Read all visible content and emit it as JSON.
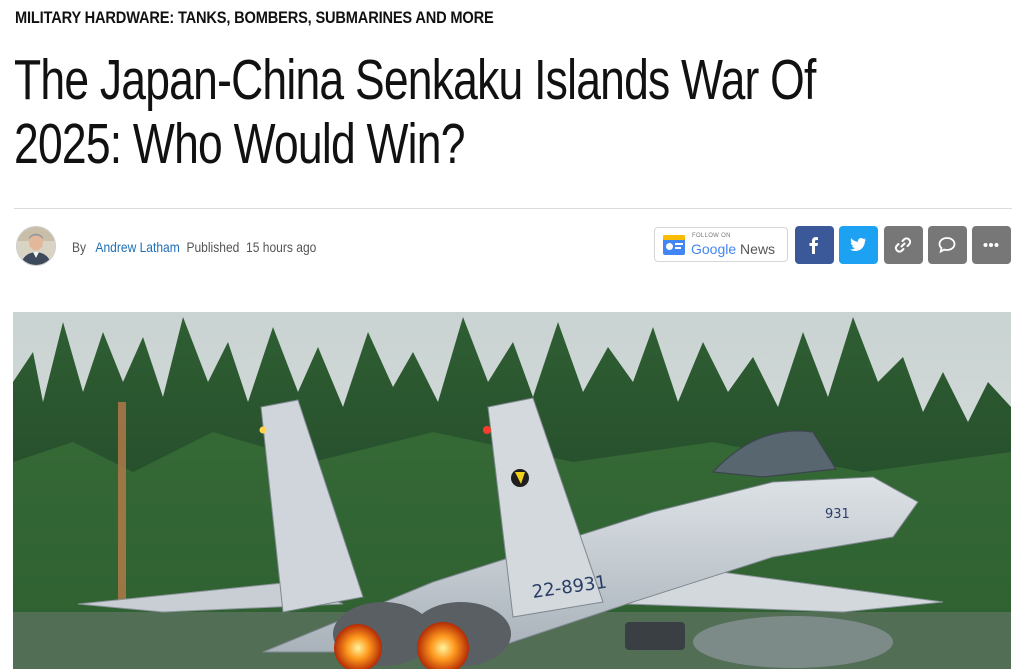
{
  "article": {
    "category": "MILITARY HARDWARE: TANKS, BOMBERS, SUBMARINES AND MORE",
    "title": "The Japan-China Senkaku Islands War Of 2025: Who Would Win?",
    "byline": {
      "by_label": "By",
      "author": "Andrew Latham",
      "published_label": "Published",
      "time": "15 hours ago"
    }
  },
  "follow_button": {
    "small_label": "FOLLOW ON",
    "label_google": "Google",
    "label_news": "News"
  },
  "share_buttons": [
    {
      "name": "facebook",
      "icon": "facebook-icon",
      "color": "#3b5998"
    },
    {
      "name": "twitter",
      "icon": "twitter-icon",
      "color": "#1da1f2"
    },
    {
      "name": "copy-link",
      "icon": "link-icon",
      "color": "#777777"
    },
    {
      "name": "comment",
      "icon": "comment-icon",
      "color": "#777777"
    },
    {
      "name": "more",
      "icon": "more-icon",
      "color": "#777777"
    }
  ],
  "hero_image": {
    "subject": "fighter-jet-photo",
    "tail_number": "22-8931",
    "nose_number": "931"
  }
}
